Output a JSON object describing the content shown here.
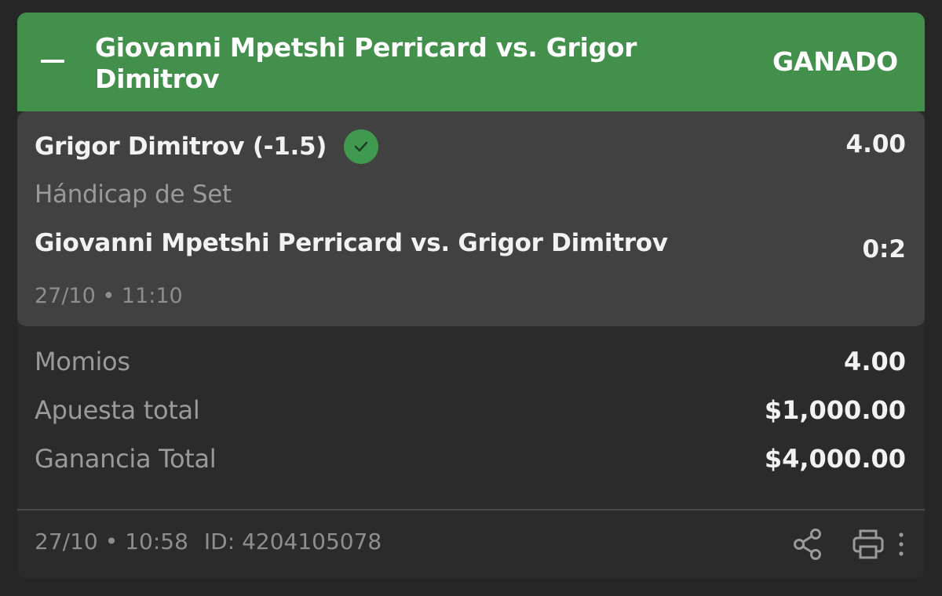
{
  "header": {
    "title": "Giovanni Mpetshi Perricard vs. Grigor Dimitrov",
    "status": "GANADO",
    "accent_color": "#43904d"
  },
  "selection": {
    "name": "Grigor Dimitrov (-1.5)",
    "odds": "4.00",
    "market": "Hándicap de Set",
    "event": "Giovanni Mpetshi Perricard vs. Grigor Dimitrov",
    "score": "0:2",
    "date": "27/10",
    "time": "11:10",
    "status_icon": "check-circle-icon",
    "status_color": "#3f9a4f"
  },
  "summary": {
    "odds_label": "Momios",
    "odds_value": "4.00",
    "stake_label": "Apuesta total",
    "stake_value": "$1,000.00",
    "payout_label": "Ganancia Total",
    "payout_value": "$4,000.00"
  },
  "footer": {
    "date": "27/10",
    "time": "10:58",
    "id_label": "ID:",
    "id_value": "4204105078",
    "icons": [
      "share-icon",
      "print-icon",
      "more-vertical-icon"
    ]
  }
}
